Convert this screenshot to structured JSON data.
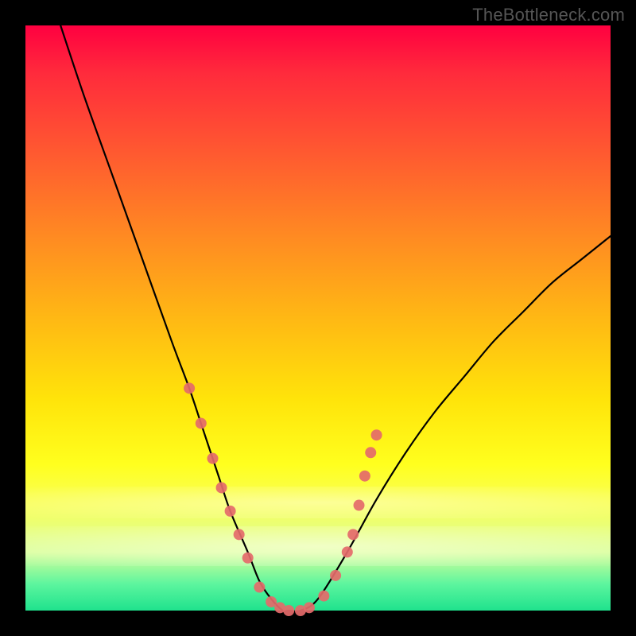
{
  "attribution": "TheBottleneck.com",
  "chart_data": {
    "type": "line",
    "title": "",
    "xlabel": "",
    "ylabel": "",
    "xlim": [
      0,
      100
    ],
    "ylim": [
      0,
      100
    ],
    "grid": false,
    "legend": false,
    "series": [
      {
        "name": "bottleneck-curve",
        "x": [
          6,
          10,
          15,
          20,
          25,
          28,
          30,
          33,
          35,
          38,
          40,
          42,
          44,
          45,
          47,
          50,
          55,
          60,
          65,
          70,
          75,
          80,
          85,
          90,
          95,
          100
        ],
        "y": [
          100,
          88,
          74,
          60,
          46,
          38,
          32,
          23,
          17,
          10,
          5,
          2,
          0,
          0,
          0,
          2,
          10,
          19,
          27,
          34,
          40,
          46,
          51,
          56,
          60,
          64
        ]
      }
    ],
    "markers": {
      "name": "bead-markers",
      "color": "#e46a6a",
      "points": [
        {
          "x": 28,
          "y": 38
        },
        {
          "x": 30,
          "y": 32
        },
        {
          "x": 32,
          "y": 26
        },
        {
          "x": 33.5,
          "y": 21
        },
        {
          "x": 35,
          "y": 17
        },
        {
          "x": 36.5,
          "y": 13
        },
        {
          "x": 38,
          "y": 9
        },
        {
          "x": 40,
          "y": 4
        },
        {
          "x": 42,
          "y": 1.5
        },
        {
          "x": 43.5,
          "y": 0.5
        },
        {
          "x": 45,
          "y": 0
        },
        {
          "x": 47,
          "y": 0
        },
        {
          "x": 48.5,
          "y": 0.5
        },
        {
          "x": 51,
          "y": 2.5
        },
        {
          "x": 53,
          "y": 6
        },
        {
          "x": 55,
          "y": 10
        },
        {
          "x": 56,
          "y": 13
        },
        {
          "x": 57,
          "y": 18
        },
        {
          "x": 58,
          "y": 23
        },
        {
          "x": 59,
          "y": 27
        },
        {
          "x": 60,
          "y": 30
        }
      ]
    }
  }
}
